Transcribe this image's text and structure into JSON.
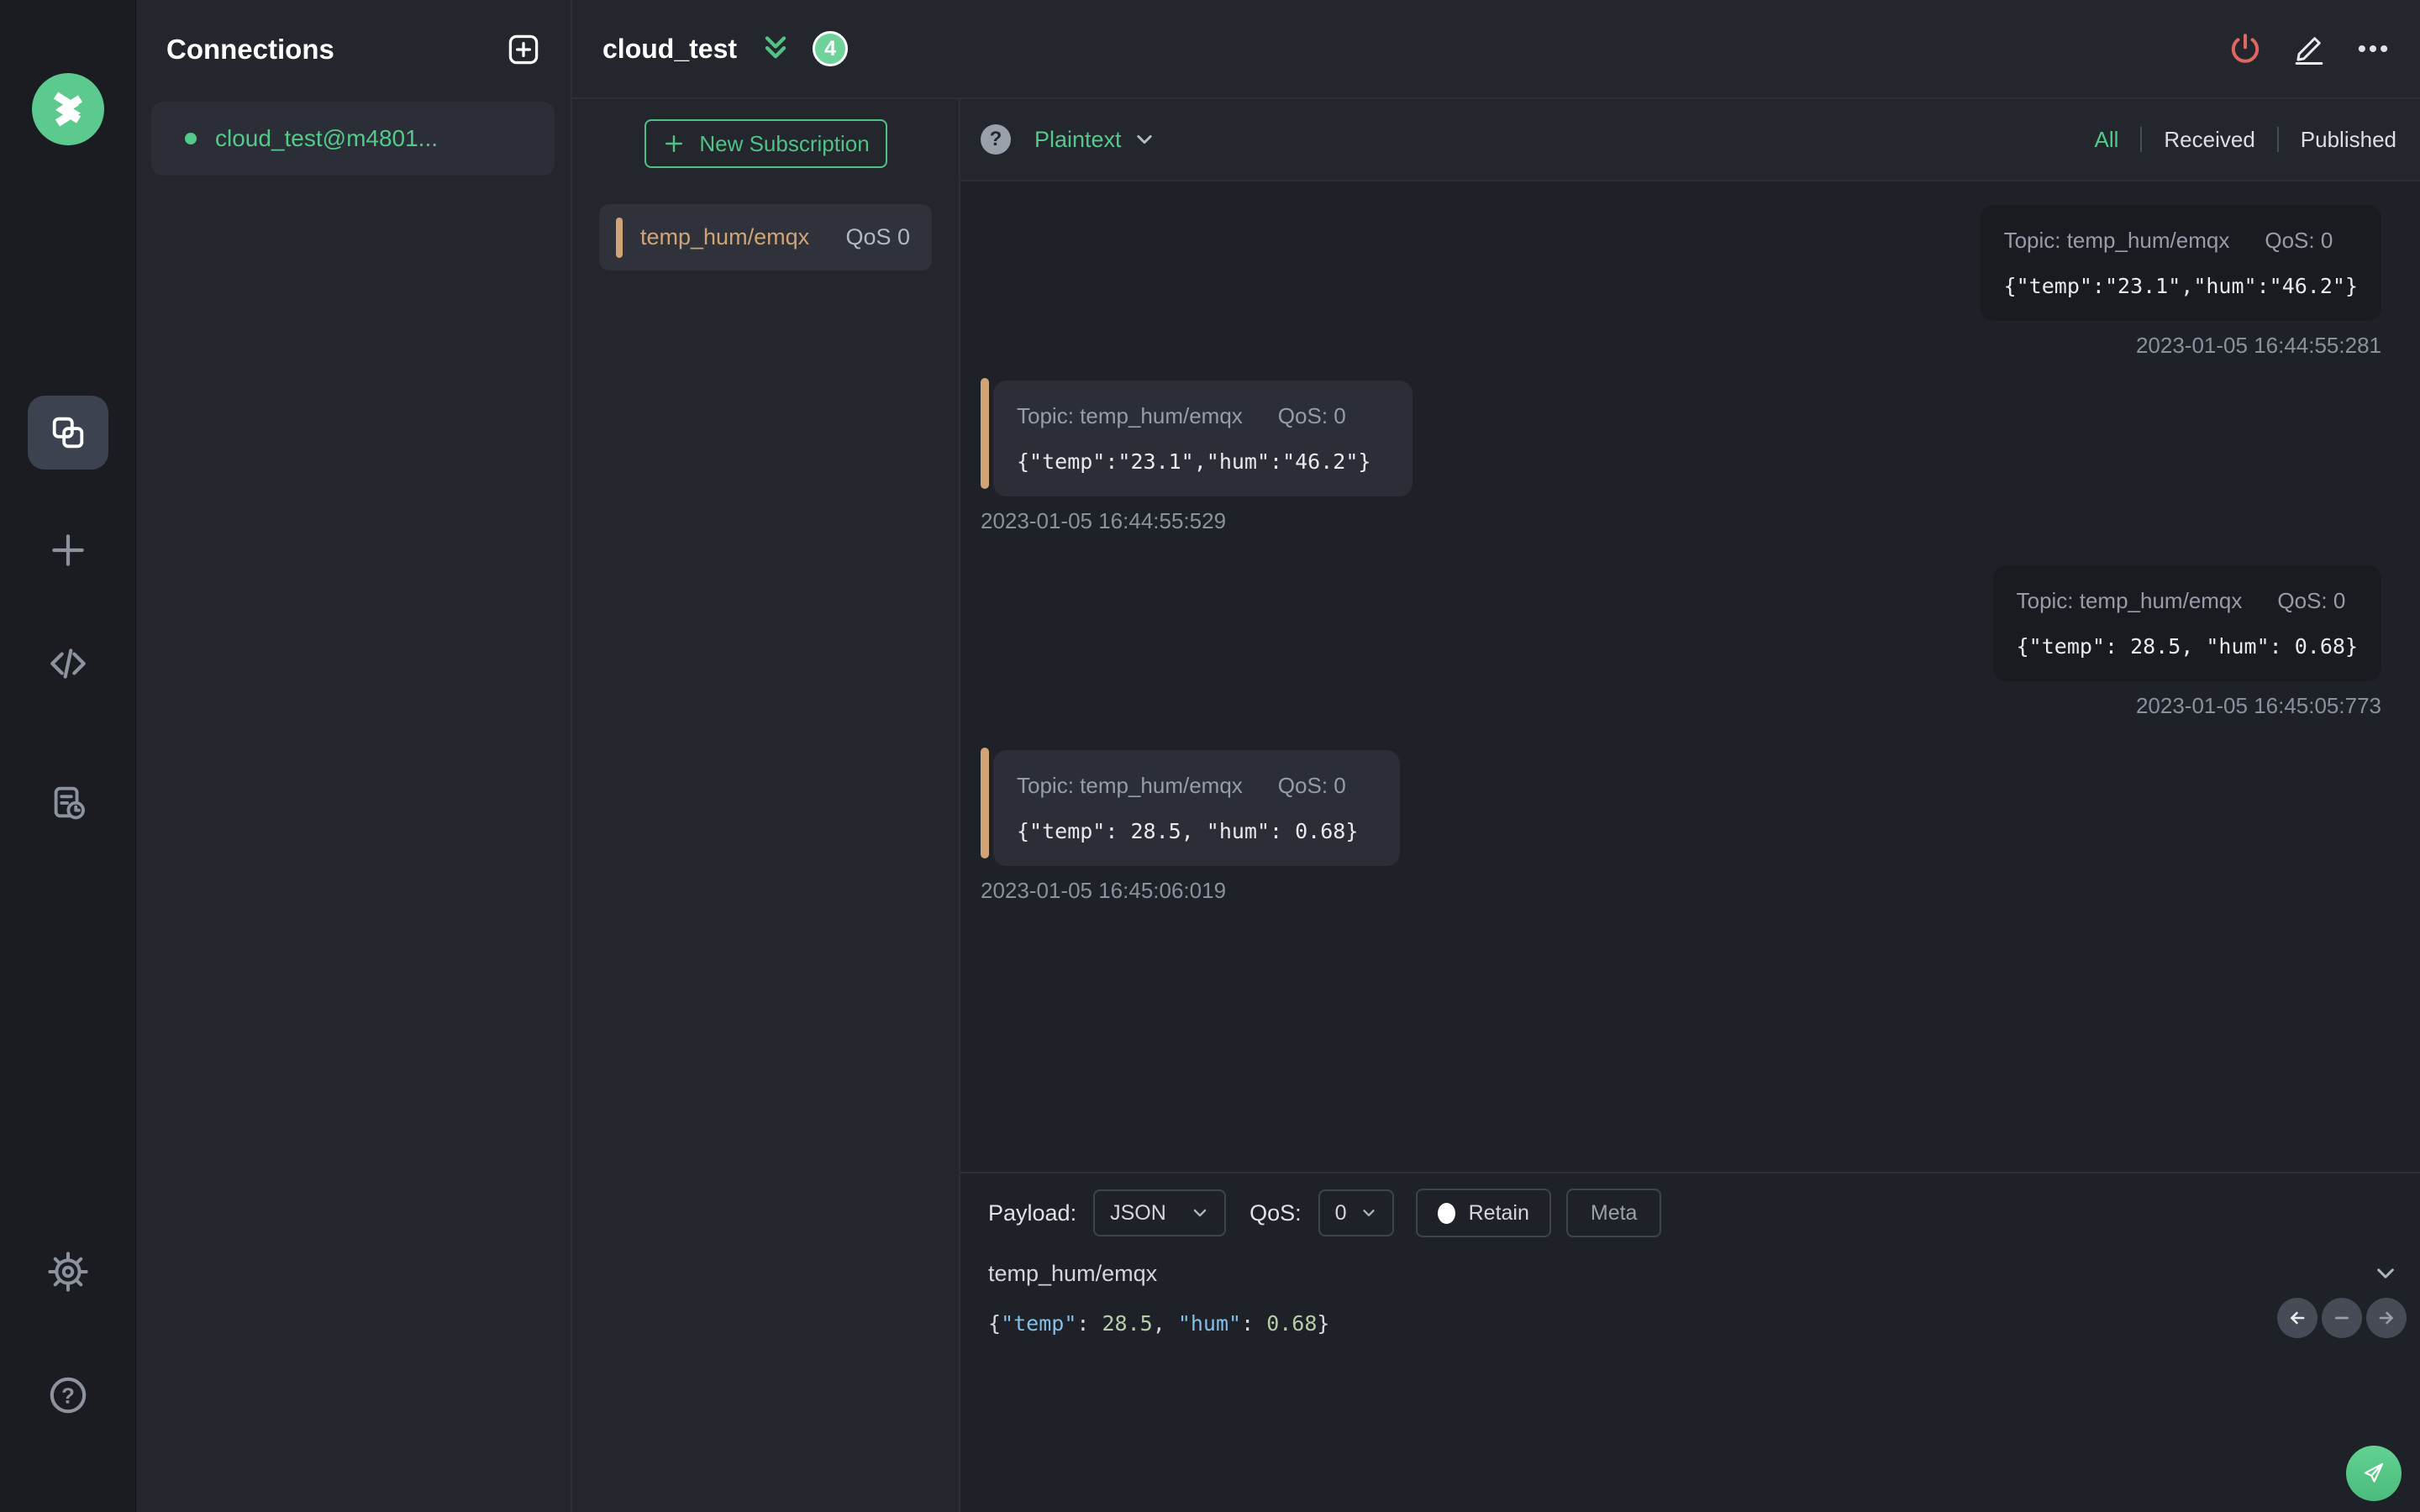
{
  "colors": {
    "accent_green": "#53c98a",
    "badge_green": "#6fd29a",
    "accent_tan": "#d0a477",
    "disconnect_red": "#e0675f",
    "syntax_key_blue": "#84bfe9",
    "syntax_number_green": "#b5cea8"
  },
  "connections_panel": {
    "title": "Connections",
    "items": [
      {
        "name": "cloud_test@m4801...",
        "status": "connected"
      }
    ]
  },
  "header": {
    "title": "cloud_test",
    "unread_badge": "4"
  },
  "subscriptions": {
    "new_subscription_label": "New Subscription",
    "items": [
      {
        "topic": "temp_hum/emqx",
        "qos": "QoS 0"
      }
    ]
  },
  "messages": {
    "format_selector": "Plaintext",
    "filters": {
      "all": "All",
      "received": "Received",
      "published": "Published",
      "active": "All"
    },
    "items": [
      {
        "direction": "published",
        "topic_label": "Topic: temp_hum/emqx",
        "qos_label": "QoS: 0",
        "payload": "{\"temp\":\"23.1\",\"hum\":\"46.2\"}",
        "timestamp": "2023-01-05 16:44:55:281"
      },
      {
        "direction": "received",
        "topic_label": "Topic: temp_hum/emqx",
        "qos_label": "QoS: 0",
        "payload": "{\"temp\":\"23.1\",\"hum\":\"46.2\"}",
        "timestamp": "2023-01-05 16:44:55:529"
      },
      {
        "direction": "published",
        "topic_label": "Topic: temp_hum/emqx",
        "qos_label": "QoS: 0",
        "payload": "{\"temp\": 28.5, \"hum\": 0.68}",
        "timestamp": "2023-01-05 16:45:05:773"
      },
      {
        "direction": "received",
        "topic_label": "Topic: temp_hum/emqx",
        "qos_label": "QoS: 0",
        "payload": "{\"temp\": 28.5, \"hum\": 0.68}",
        "timestamp": "2023-01-05 16:45:06:019"
      }
    ]
  },
  "publish": {
    "payload_label": "Payload:",
    "payload_format": "JSON",
    "qos_label": "QoS:",
    "qos_value": "0",
    "retain_label": "Retain",
    "meta_label": "Meta",
    "topic_value": "temp_hum/emqx",
    "editor_tokens": {
      "open_brace": "{",
      "key_temp": "\"temp\"",
      "colon1": ": ",
      "val_temp": "28.5",
      "comma": ", ",
      "key_hum": "\"hum\"",
      "colon2": ": ",
      "val_hum": "0.68",
      "close_brace": "}"
    }
  }
}
